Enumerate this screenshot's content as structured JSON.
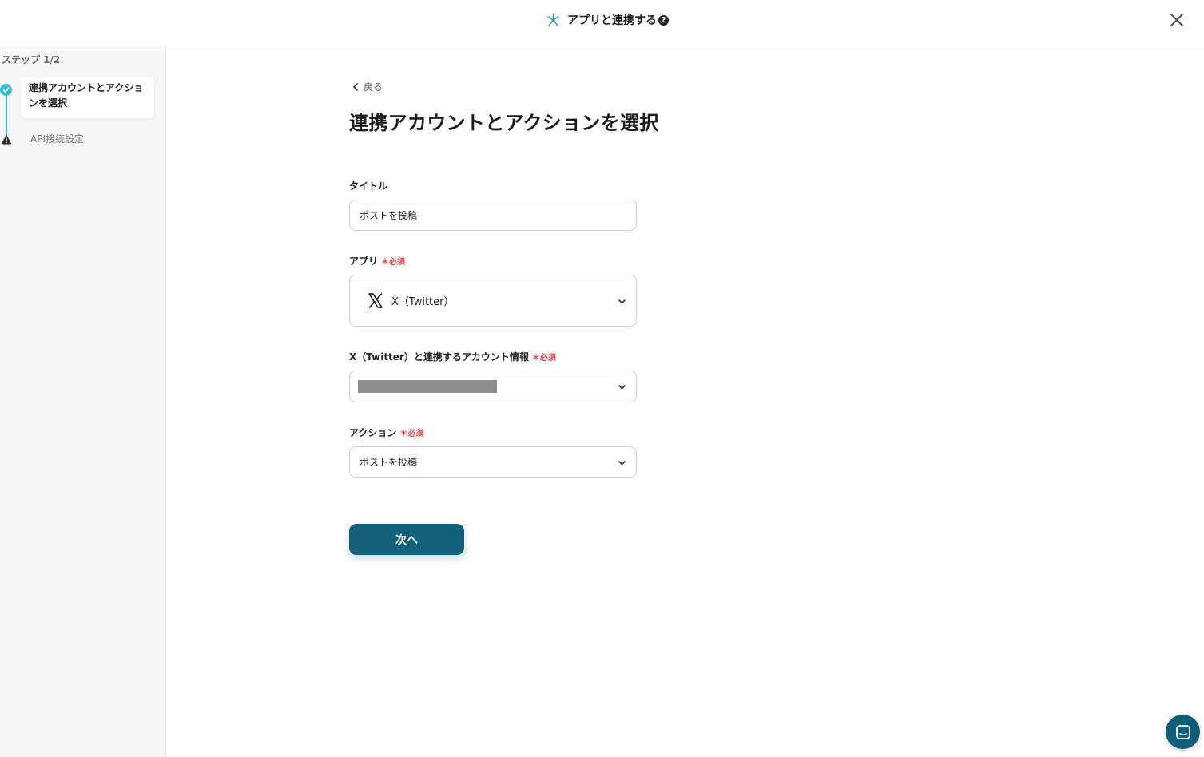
{
  "header": {
    "title": "アプリと連携する",
    "help_icon": "?",
    "colors": {
      "accent": "#36bfd0"
    }
  },
  "sidebar": {
    "step_label": "ステップ 1/2",
    "steps": [
      {
        "label": "連携アカウントとアクションを選択",
        "status": "complete"
      },
      {
        "label": "API接続設定",
        "status": "warning"
      }
    ]
  },
  "main": {
    "back_label": "戻る",
    "title": "連携アカウントとアクションを選択",
    "required_mark": "＊必須",
    "fields": {
      "title": {
        "label": "タイトル",
        "value": "ポストを投稿"
      },
      "app": {
        "label": "アプリ",
        "value": "X（Twitter）",
        "icon": "x-logo-icon"
      },
      "account": {
        "label": "X（Twitter）と連携するアカウント情報",
        "value": ""
      },
      "action": {
        "label": "アクション",
        "value": "ポストを投稿"
      }
    },
    "next_label": "次へ",
    "colors": {
      "primary": "#145f79",
      "required": "#e5484d"
    }
  }
}
